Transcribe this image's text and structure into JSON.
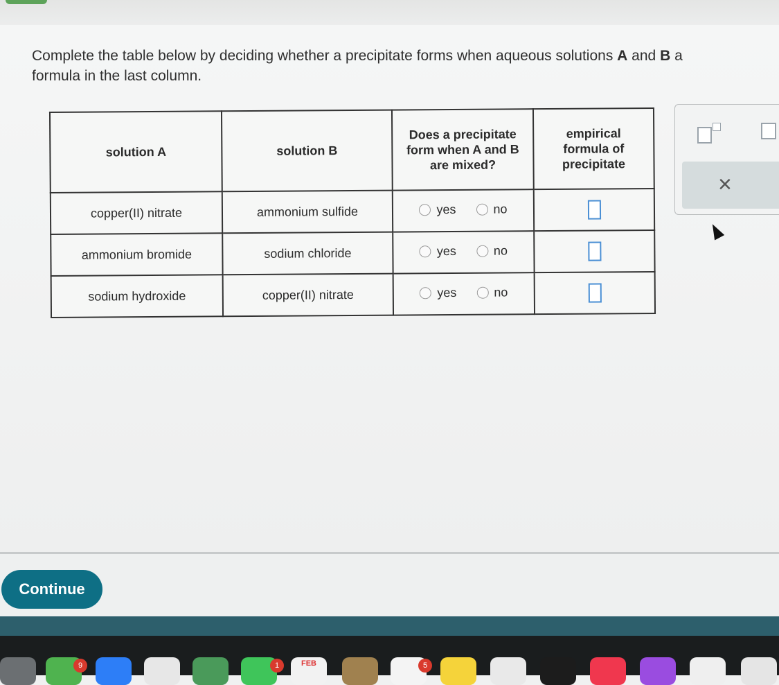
{
  "prompt": {
    "part1": "Complete the table below by deciding whether a precipitate forms when aqueous solutions ",
    "bold_a": "A",
    "and": " and ",
    "bold_b": "B",
    "part2": " a",
    "line2": "formula in the last column."
  },
  "table": {
    "headers": {
      "solution_a": "solution A",
      "solution_b": "solution B",
      "precipitate_q": "Does a precipitate form when A and B are mixed?",
      "formula": "empirical formula of precipitate"
    },
    "rows": [
      {
        "a": "copper(II) nitrate",
        "b": "ammonium sulfide",
        "yes": "yes",
        "no": "no"
      },
      {
        "a": "ammonium bromide",
        "b": "sodium chloride",
        "yes": "yes",
        "no": "no"
      },
      {
        "a": "sodium hydroxide",
        "b": "copper(II) nitrate",
        "yes": "yes",
        "no": "no"
      }
    ]
  },
  "side_panel": {
    "clear_symbol": "×"
  },
  "footer": {
    "continue_label": "Continue"
  },
  "dock": {
    "badges": [
      "9",
      "1",
      "5"
    ],
    "calendar_month": "FEB"
  },
  "colors": {
    "accent": "#0e6f85",
    "answer_box": "#4a8fd4"
  }
}
